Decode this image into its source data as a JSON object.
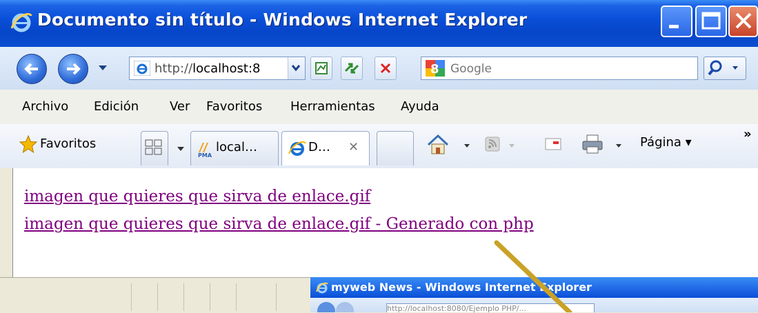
{
  "window": {
    "title": "Documento sin título - Windows Internet Explorer"
  },
  "address": {
    "url_prefix": "http://",
    "url_host": "localhost:8",
    "search_placeholder": "Google"
  },
  "menu": [
    "Archivo",
    "Edición",
    "Ver",
    "Favoritos",
    "Herramientas",
    "Ayuda"
  ],
  "toolbar": {
    "favorites_label": "Favoritos",
    "tabs": [
      {
        "label": "local…"
      },
      {
        "label": "D…"
      }
    ],
    "tab_close": "✕",
    "page_menu": "Página ▾",
    "chevron": "»"
  },
  "content": {
    "links": [
      "imagen que quieres que sirva de enlace.gif",
      "imagen que quieres que sirva de enlace.gif - Generado con php"
    ]
  },
  "overlay_window": {
    "title": "myweb News - Windows Internet Explorer",
    "url": "http://localhost:8080/Ejemplo PHP/..."
  },
  "colors": {
    "titlebar": "#0a4fd8",
    "visited_link": "#800080",
    "arrow": "#c9a227"
  }
}
